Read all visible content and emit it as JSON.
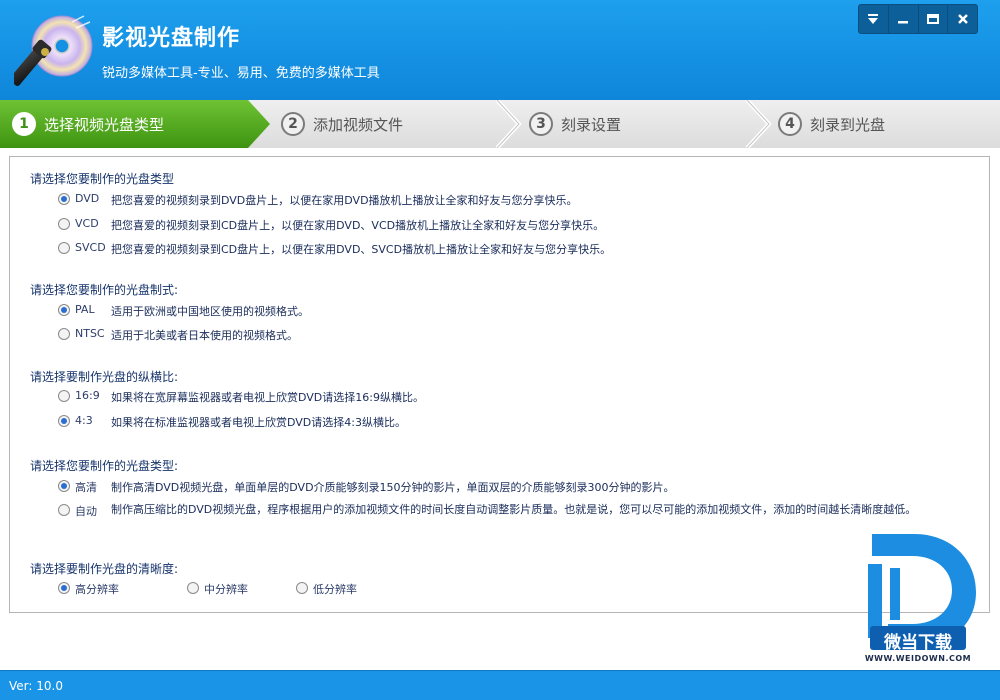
{
  "header": {
    "title": "影视光盘制作",
    "subtitle": "锐动多媒体工具-专业、易用、免费的多媒体工具"
  },
  "steps": [
    {
      "num": "1",
      "label": "选择视频光盘类型"
    },
    {
      "num": "2",
      "label": "添加视频文件"
    },
    {
      "num": "3",
      "label": "刻录设置"
    },
    {
      "num": "4",
      "label": "刻录到光盘"
    }
  ],
  "disc_type": {
    "title": "请选择您要制作的光盘类型",
    "options": [
      {
        "name": "DVD",
        "desc": "把您喜爱的视频刻录到DVD盘片上，以便在家用DVD播放机上播放让全家和好友与您分享快乐。",
        "checked": true
      },
      {
        "name": "VCD",
        "desc": "把您喜爱的视频刻录到CD盘片上，以便在家用DVD、VCD播放机上播放让全家和好友与您分享快乐。",
        "checked": false
      },
      {
        "name": "SVCD",
        "desc": "把您喜爱的视频刻录到CD盘片上，以便在家用DVD、SVCD播放机上播放让全家和好友与您分享快乐。",
        "checked": false
      }
    ]
  },
  "tv_system": {
    "title": "请选择您要制作的光盘制式:",
    "options": [
      {
        "name": "PAL",
        "desc": "适用于欧洲或中国地区使用的视频格式。",
        "checked": true
      },
      {
        "name": "NTSC",
        "desc": "适用于北美或者日本使用的视频格式。",
        "checked": false
      }
    ]
  },
  "aspect": {
    "title": "请选择要制作光盘的纵横比:",
    "options": [
      {
        "name": "16:9",
        "desc": "如果将在宽屏幕监视器或者电视上欣赏DVD请选择16:9纵横比。",
        "checked": false
      },
      {
        "name": "4:3",
        "desc": "如果将在标准监视器或者电视上欣赏DVD请选择4:3纵横比。",
        "checked": true
      }
    ]
  },
  "quality_type": {
    "title": "请选择您要制作的光盘类型:",
    "options": [
      {
        "name": "高清",
        "desc": "制作高清DVD视频光盘，单面单层的DVD介质能够刻录150分钟的影片，单面双层的介质能够刻录300分钟的影片。",
        "checked": true
      },
      {
        "name": "自动",
        "desc": "制作高压缩比的DVD视频光盘，程序根据用户的添加视频文件的时间长度自动调整影片质量。也就是说，您可以尽可能的添加视频文件，添加的时间越长清晰度越低。",
        "checked": false
      }
    ]
  },
  "resolution": {
    "title": "请选择要制作光盘的清晰度:",
    "options": [
      {
        "name": "高分辨率",
        "checked": true
      },
      {
        "name": "中分辨率",
        "checked": false
      },
      {
        "name": "低分辨率",
        "checked": false
      }
    ]
  },
  "footer": {
    "version": "Ver: 10.0"
  },
  "watermark": {
    "text": "微当下载",
    "url": "WWW.WEIDOWN.COM"
  },
  "colors": {
    "header": "#1591e3",
    "active_step": "#4ea21d",
    "footer": "#1a94e6",
    "watermark": "#1c8de0"
  },
  "icons": [
    "disc-torch-logo",
    "menu-icon",
    "minimize-icon",
    "maximize-icon",
    "close-icon"
  ]
}
